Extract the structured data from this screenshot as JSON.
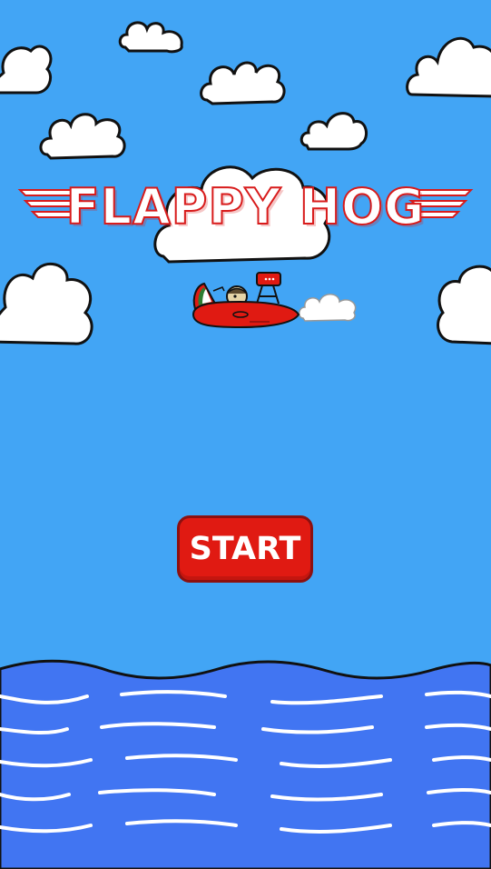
{
  "game": {
    "title": "FLAPPY HOG",
    "start_label": "START"
  },
  "colors": {
    "sky": "#42a5f5",
    "sea": "#4175f2",
    "button": "#e01a12",
    "title_outline": "#d81b1b",
    "plane": "#e01a12"
  },
  "icons": {
    "plane": "plane-icon",
    "clouds": "cloud-icon"
  }
}
